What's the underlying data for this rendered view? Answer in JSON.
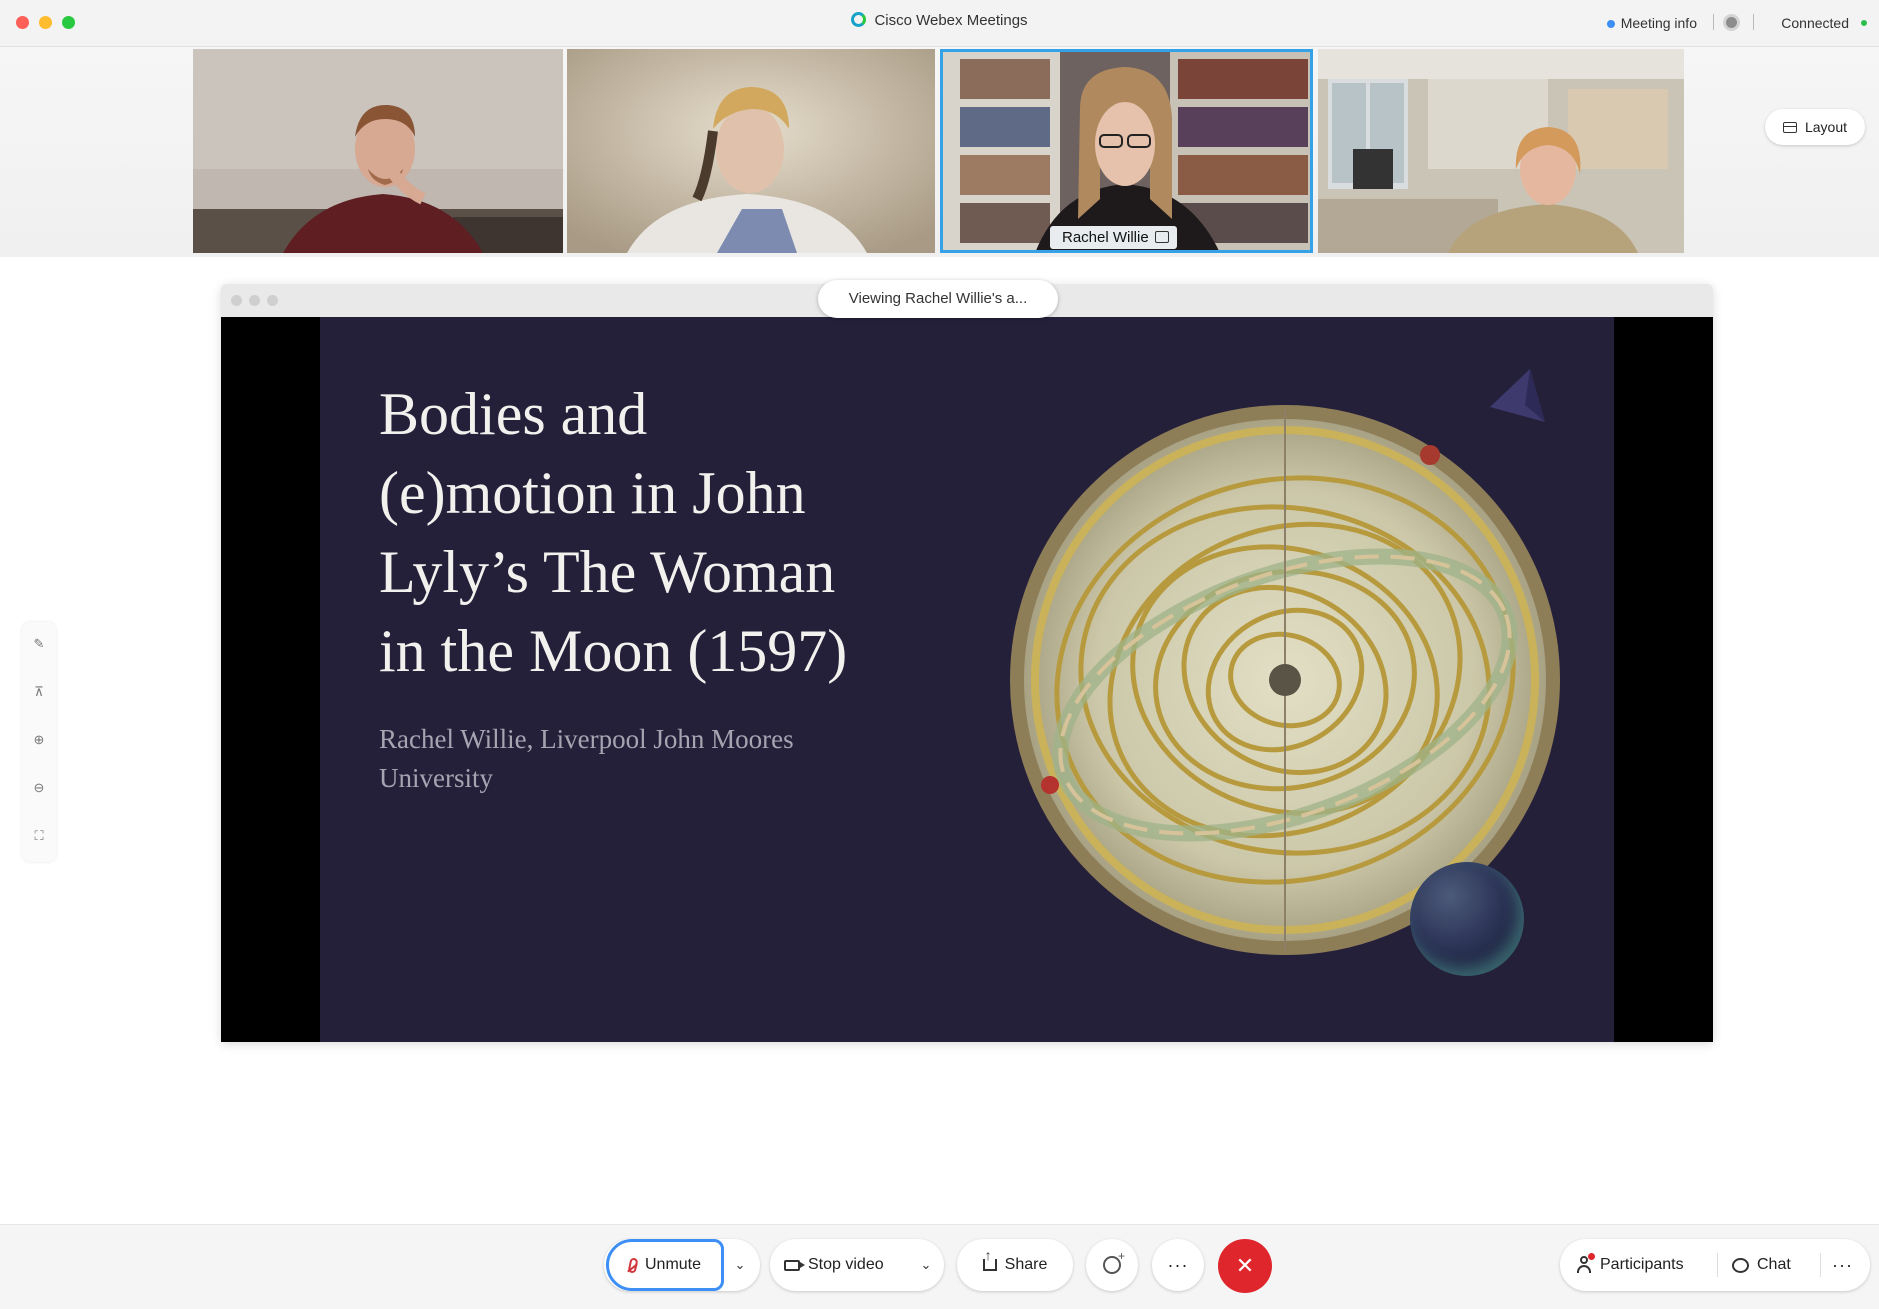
{
  "titlebar": {
    "app_title": "Cisco Webex Meetings",
    "meeting_info": "Meeting info",
    "status": "Connected"
  },
  "participants_strip": {
    "tiles": [
      {
        "name": ""
      },
      {
        "name": ""
      },
      {
        "name": "Rachel Willie",
        "active": true
      },
      {
        "name": ""
      }
    ],
    "layout_label": "Layout"
  },
  "share": {
    "viewing_label": "Viewing Rachel Willie's a...",
    "slide": {
      "title_lines": [
        "Bodies and",
        "(e)motion in John",
        "Lyly’s The Woman",
        "in the Moon (1597)"
      ],
      "subtitle_lines": [
        "Rachel Willie, Liverpool John Moores",
        "University"
      ]
    }
  },
  "left_rail": {
    "icons": [
      "annotate-icon",
      "pin-icon",
      "zoom-in-icon",
      "zoom-out-icon",
      "fit-icon"
    ]
  },
  "controls": {
    "unmute_label": "Unmute",
    "video_label": "Stop video",
    "share_label": "Share",
    "participants_label": "Participants",
    "chat_label": "Chat",
    "more_symbol": "···",
    "leave_symbol": "✕"
  },
  "colors": {
    "accent": "#3d8ff5",
    "leave_red": "#e0262d",
    "slide_bg": "#25203a",
    "slide_text": "#f3f1ee"
  }
}
